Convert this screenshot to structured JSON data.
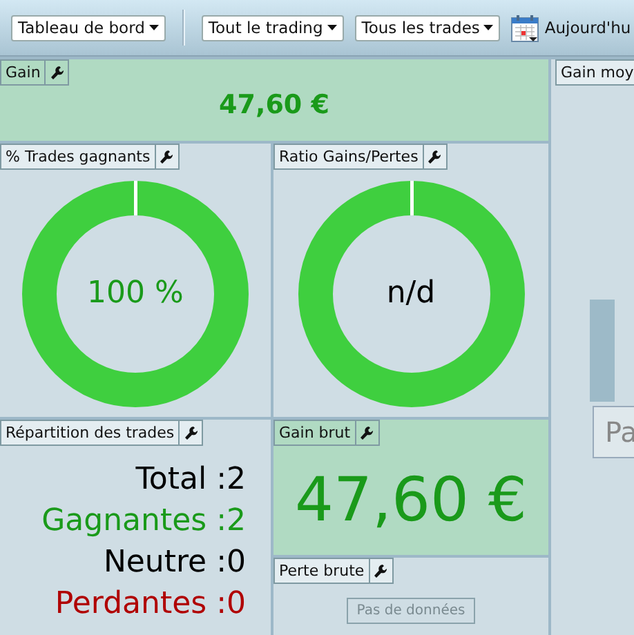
{
  "toolbar": {
    "dropdowns": [
      {
        "label": "Tableau de bord"
      },
      {
        "label": "Tout le trading"
      },
      {
        "label": "Tous les trades"
      }
    ],
    "date_button": {
      "label": "Aujourd'hu"
    }
  },
  "gain": {
    "title": "Gain",
    "value": "47,60 €"
  },
  "win_rate": {
    "title": "% Trades gagnants",
    "value": "100 %"
  },
  "ratio": {
    "title": "Ratio Gains/Pertes",
    "value": "n/d"
  },
  "breakdown": {
    "title": "Répartition des trades",
    "rows": [
      {
        "label": "Total",
        "separator": ":",
        "value": "2",
        "kind": "neutral"
      },
      {
        "label": "Gagnantes",
        "separator": ":",
        "value": "2",
        "kind": "win"
      },
      {
        "label": "Neutre",
        "separator": ":",
        "value": "0",
        "kind": "neutral"
      },
      {
        "label": "Perdantes",
        "separator": ":",
        "value": "0",
        "kind": "loss"
      }
    ]
  },
  "gross_gain": {
    "title": "Gain brut",
    "value": "47,60 €"
  },
  "gross_loss": {
    "title": "Perte brute",
    "empty_label": "Pas de données"
  },
  "average_gain": {
    "title": "Gain moy",
    "button_label": "Pa"
  }
}
